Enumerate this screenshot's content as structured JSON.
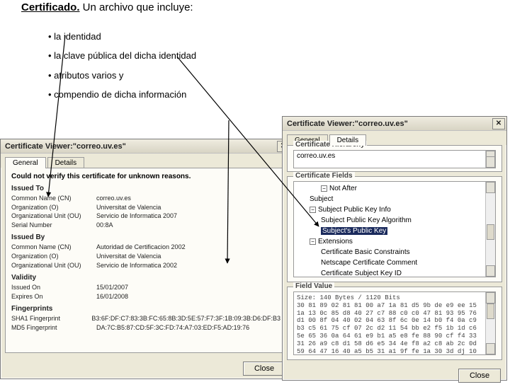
{
  "slide": {
    "title_bold": "Certificado.",
    "title_rest": " Un archivo que incluye:",
    "bullets": [
      "la identidad",
      "la clave pública del dicha identidad",
      "atributos varios y",
      "compendio de dicha información"
    ]
  },
  "winLeft": {
    "title": "Certificate Viewer:\"correo.uv.es\"",
    "tab_general": "General",
    "tab_details": "Details",
    "verify_msg": "Could not verify this certificate for unknown reasons.",
    "issued_to_h": "Issued To",
    "issued_by_h": "Issued By",
    "validity_h": "Validity",
    "fprint_h": "Fingerprints",
    "kv_cn": "Common Name (CN)",
    "kv_o": "Organization (O)",
    "kv_ou": "Organizational Unit (OU)",
    "kv_sn": "Serial Number",
    "kv_issued_on": "Issued On",
    "kv_expires_on": "Expires On",
    "kv_sha1": "SHA1 Fingerprint",
    "kv_md5": "MD5 Fingerprint",
    "to_cn": "correo.uv.es",
    "to_o": "Universitat de Valencia",
    "to_ou": "Servicio de Informatica 2007",
    "to_sn": "00:8A",
    "by_cn": "Autoridad de Certificacion 2002",
    "by_o": "Universitat de Valencia",
    "by_ou": "Servicio de Informatica 2002",
    "issued_on": "15/01/2007",
    "expires_on": "16/01/2008",
    "sha1": "B3:6F:DF:C7:83:3B:FC:65:8B:3D:5E:57:F7:3F:1B:09:3B:D6:DF:B3",
    "md5": "DA:7C:B5:87:CD:5F:3C:FD:74:A7:03:ED:F5:AD:19:76",
    "close_btn": "Close"
  },
  "winRight": {
    "title": "Certificate Viewer:\"correo.uv.es\"",
    "tab_general": "General",
    "tab_details": "Details",
    "hierarchy_label": "Certificate Hierarchy",
    "hierarchy_root": "correo.uv.es",
    "fields_label": "Certificate Fields",
    "tree": {
      "not_after": "Not After",
      "subject": "Subject",
      "pki": "Subject Public Key Info",
      "pka": "Subject Public Key Algorithm",
      "spk": "Subject's Public Key",
      "ext": "Extensions",
      "bc": "Certificate Basic Constraints",
      "cc": "Netscape Certificate Comment",
      "skid": "Certificate Subject Key ID"
    },
    "value_label": "Field Value",
    "hex_lines": [
      "Size: 140 Bytes / 1120 Bits",
      "30 81 89 02 81 81 00 a7 1a 81 d5 9b de e9 ee 15",
      "1a 13 0c 85 d8 40 27 c7 88 c0 c0 47 81 93 95 76",
      "d1 00 8f 04 40 02 04 63 8f 6c 0e 14 b0 f4 0a c9",
      "b3 c5 61 75 cf 07 2c d2 11 54 bb e2 f5 1b 1d c6",
      "5e 65 36 0a 64 61 e9 b1 a5 e8 fe 88 90 cf f4 33",
      "31 26 a9 c8 d1 58 d6 e5 34 4e f8 a2 c8 ab 2c 0d",
      "59 64 47 16 40 a5 b5 31 a1 9f fe 1a 30 3d dj 10"
    ],
    "close_btn": "Close"
  }
}
